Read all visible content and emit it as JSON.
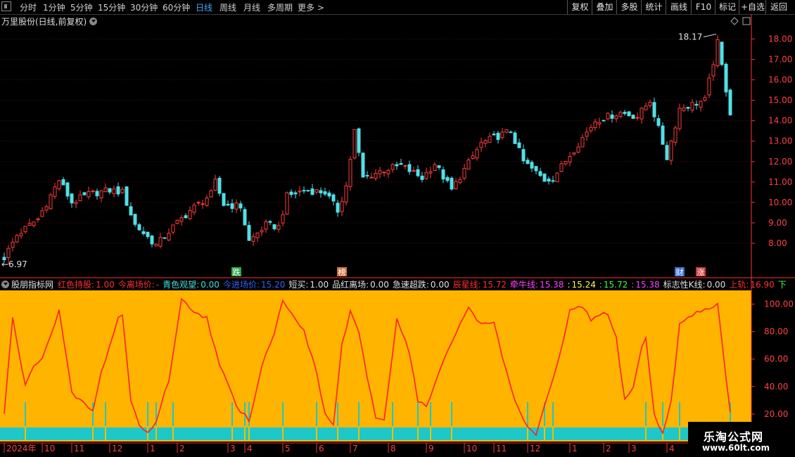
{
  "toolbar": {
    "timeframes": [
      "分时",
      "1分钟",
      "5分钟",
      "15分钟",
      "30分钟",
      "60分钟",
      "日线",
      "周线",
      "月线",
      "多周期",
      "更多 >"
    ],
    "active_timeframe": "日线",
    "right_buttons": [
      "复权",
      "叠加",
      "多股",
      "统计",
      "画线",
      "F10",
      "标记",
      "+自选",
      "返回"
    ]
  },
  "price_panel": {
    "title": "万里股份(日线,前复权)",
    "high_label": "18.17",
    "low_label": "6.97",
    "markers": [
      {
        "text": "跌",
        "color": "#2aa84a",
        "index": 55
      },
      {
        "text": "榜",
        "color": "#c8783c",
        "index": 80
      },
      {
        "text": "财",
        "color": "#3a72d0",
        "index": 160
      },
      {
        "text": "涨",
        "color": "#c83a3a",
        "index": 165
      }
    ]
  },
  "indicator_panel": {
    "name": "股朋指标网",
    "values": [
      {
        "label": "红色持股:",
        "value": "1.00",
        "color": "#ff3030"
      },
      {
        "label": "今离场价:",
        "value": "-",
        "color": "#ff3030"
      },
      {
        "label": "青色观望:",
        "value": "0.00",
        "color": "#40e0e0"
      },
      {
        "label": "今进场价:",
        "value": "15.20",
        "color": "#3060ff"
      },
      {
        "label": "短买:",
        "value": "1.00",
        "color": "#e0e0e0"
      },
      {
        "label": "品红离场:",
        "value": "0.00",
        "color": "#e0e0e0"
      },
      {
        "label": "急速超跌:",
        "value": "0.00",
        "color": "#e0e0e0"
      },
      {
        "label": "辰星线:",
        "value": "15.72",
        "color": "#ff3030"
      },
      {
        "label": "牵牛线:",
        "value": "15.38",
        "color": "#ff40ff"
      },
      {
        "label": ":",
        "value": "15.24",
        "color": "#ffff40"
      },
      {
        "label": ":",
        "value": "15.72",
        "color": "#40ff40"
      },
      {
        "label": ":",
        "value": "15.38",
        "color": "#ff40ff"
      },
      {
        "label": "标志性K线:",
        "value": "0.00",
        "color": "#e0e0e0"
      },
      {
        "label": "上轨:",
        "value": "16.90",
        "color": "#ff3030"
      },
      {
        "label": "下",
        "value": "",
        "color": "#40ff40"
      }
    ]
  },
  "x_axis_labels": [
    {
      "text": "2024年",
      "i": 0
    },
    {
      "text": "10",
      "i": 9
    },
    {
      "text": "11",
      "i": 16
    },
    {
      "text": "12",
      "i": 25
    },
    {
      "text": "1",
      "i": 34
    },
    {
      "text": "2",
      "i": 41
    },
    {
      "text": "3",
      "i": 53
    },
    {
      "text": "4",
      "i": 57
    },
    {
      "text": "5",
      "i": 66
    },
    {
      "text": "6",
      "i": 74
    },
    {
      "text": "7",
      "i": 82
    },
    {
      "text": "8",
      "i": 91
    },
    {
      "text": "9",
      "i": 100
    },
    {
      "text": "10",
      "i": 109
    },
    {
      "text": "11",
      "i": 116
    },
    {
      "text": "12",
      "i": 124
    },
    {
      "text": "1",
      "i": 134
    },
    {
      "text": "2",
      "i": 142
    },
    {
      "text": "3",
      "i": 148
    },
    {
      "text": "4",
      "i": 157
    }
  ],
  "watermark": {
    "line1": "乐淘公式网",
    "line2": "www.60lt.com"
  },
  "colors": {
    "up": "#ff3b3b",
    "down": "#4fe0e8",
    "indicator_bg": "#ffb400",
    "cyan_band": "#1ec8c8",
    "osc_line": "#ff2020",
    "axis": "#ff3030"
  },
  "chart_data": [
    {
      "type": "candlestick",
      "title": "万里股份(日线,前复权)",
      "ylim": [
        6.9,
        18.6
      ],
      "yticks": [
        8,
        9,
        10,
        11,
        12,
        13,
        14,
        15,
        16,
        17,
        18
      ],
      "close_knots": [
        [
          0,
          7.3
        ],
        [
          3,
          8.4
        ],
        [
          8,
          9.2
        ],
        [
          13,
          11.1
        ],
        [
          16,
          10
        ],
        [
          20,
          10.4
        ],
        [
          25,
          10.6
        ],
        [
          28,
          10.5
        ],
        [
          31,
          8.9
        ],
        [
          36,
          7.9
        ],
        [
          40,
          8.8
        ],
        [
          44,
          9.6
        ],
        [
          49,
          10.4
        ],
        [
          50,
          11.0
        ],
        [
          52,
          9.9
        ],
        [
          56,
          9.8
        ],
        [
          58,
          8.1
        ],
        [
          62,
          8.9
        ],
        [
          65,
          8.8
        ],
        [
          67,
          10.3
        ],
        [
          71,
          10.6
        ],
        [
          76,
          10.5
        ],
        [
          79,
          9.6
        ],
        [
          81,
          10.8
        ],
        [
          83,
          13.5
        ],
        [
          85,
          11.2
        ],
        [
          90,
          11.6
        ],
        [
          94,
          11.8
        ],
        [
          99,
          11.2
        ],
        [
          102,
          11.9
        ],
        [
          106,
          10.6
        ],
        [
          109,
          11.6
        ],
        [
          113,
          12.9
        ],
        [
          120,
          13.5
        ],
        [
          123,
          12.0
        ],
        [
          128,
          11.1
        ],
        [
          130,
          11.2
        ],
        [
          135,
          12.6
        ],
        [
          140,
          14.0
        ],
        [
          146,
          14.4
        ],
        [
          150,
          14.2
        ],
        [
          153,
          15.0
        ],
        [
          157,
          12.2
        ],
        [
          160,
          14.6
        ],
        [
          166,
          15.0
        ],
        [
          169,
          17.8
        ],
        [
          172,
          14.4
        ]
      ]
    },
    {
      "type": "line",
      "title": "股朋指标网",
      "ylim": [
        0,
        110
      ],
      "yticks": [
        20,
        40,
        60,
        80,
        100
      ],
      "curve_knots": [
        [
          0,
          20
        ],
        [
          2,
          90
        ],
        [
          5,
          40
        ],
        [
          7,
          55
        ],
        [
          9,
          62
        ],
        [
          12,
          85
        ],
        [
          13,
          95
        ],
        [
          16,
          35
        ],
        [
          18,
          30
        ],
        [
          21,
          22
        ],
        [
          23,
          50
        ],
        [
          27,
          90
        ],
        [
          28,
          92
        ],
        [
          30,
          30
        ],
        [
          32,
          12
        ],
        [
          34,
          6
        ],
        [
          36,
          15
        ],
        [
          39,
          45
        ],
        [
          42,
          103
        ],
        [
          45,
          95
        ],
        [
          48,
          90
        ],
        [
          51,
          55
        ],
        [
          53,
          42
        ],
        [
          55,
          25
        ],
        [
          57,
          20
        ],
        [
          58,
          15
        ],
        [
          61,
          55
        ],
        [
          64,
          80
        ],
        [
          66,
          102
        ],
        [
          68,
          95
        ],
        [
          71,
          80
        ],
        [
          74,
          50
        ],
        [
          76,
          20
        ],
        [
          78,
          12
        ],
        [
          80,
          70
        ],
        [
          82,
          95
        ],
        [
          84,
          80
        ],
        [
          86,
          45
        ],
        [
          88,
          18
        ],
        [
          90,
          15
        ],
        [
          93,
          90
        ],
        [
          96,
          65
        ],
        [
          98,
          30
        ],
        [
          100,
          25
        ],
        [
          103,
          50
        ],
        [
          106,
          72
        ],
        [
          110,
          98
        ],
        [
          113,
          85
        ],
        [
          116,
          88
        ],
        [
          118,
          60
        ],
        [
          121,
          30
        ],
        [
          124,
          10
        ],
        [
          126,
          5
        ],
        [
          129,
          35
        ],
        [
          131,
          55
        ],
        [
          134,
          95
        ],
        [
          137,
          98
        ],
        [
          139,
          88
        ],
        [
          141,
          93
        ],
        [
          143,
          92
        ],
        [
          145,
          75
        ],
        [
          147,
          30
        ],
        [
          149,
          40
        ],
        [
          151,
          68
        ],
        [
          152,
          75
        ],
        [
          154,
          20
        ],
        [
          156,
          5
        ],
        [
          158,
          30
        ],
        [
          160,
          85
        ],
        [
          162,
          90
        ],
        [
          165,
          95
        ],
        [
          167,
          97
        ],
        [
          169,
          100
        ],
        [
          172,
          20
        ]
      ],
      "signal_indices": [
        5,
        21,
        24,
        34,
        36,
        40,
        54,
        57,
        58,
        66,
        74,
        79,
        84,
        92,
        98,
        101,
        106,
        124,
        128,
        130,
        152,
        156,
        160,
        172
      ]
    }
  ]
}
